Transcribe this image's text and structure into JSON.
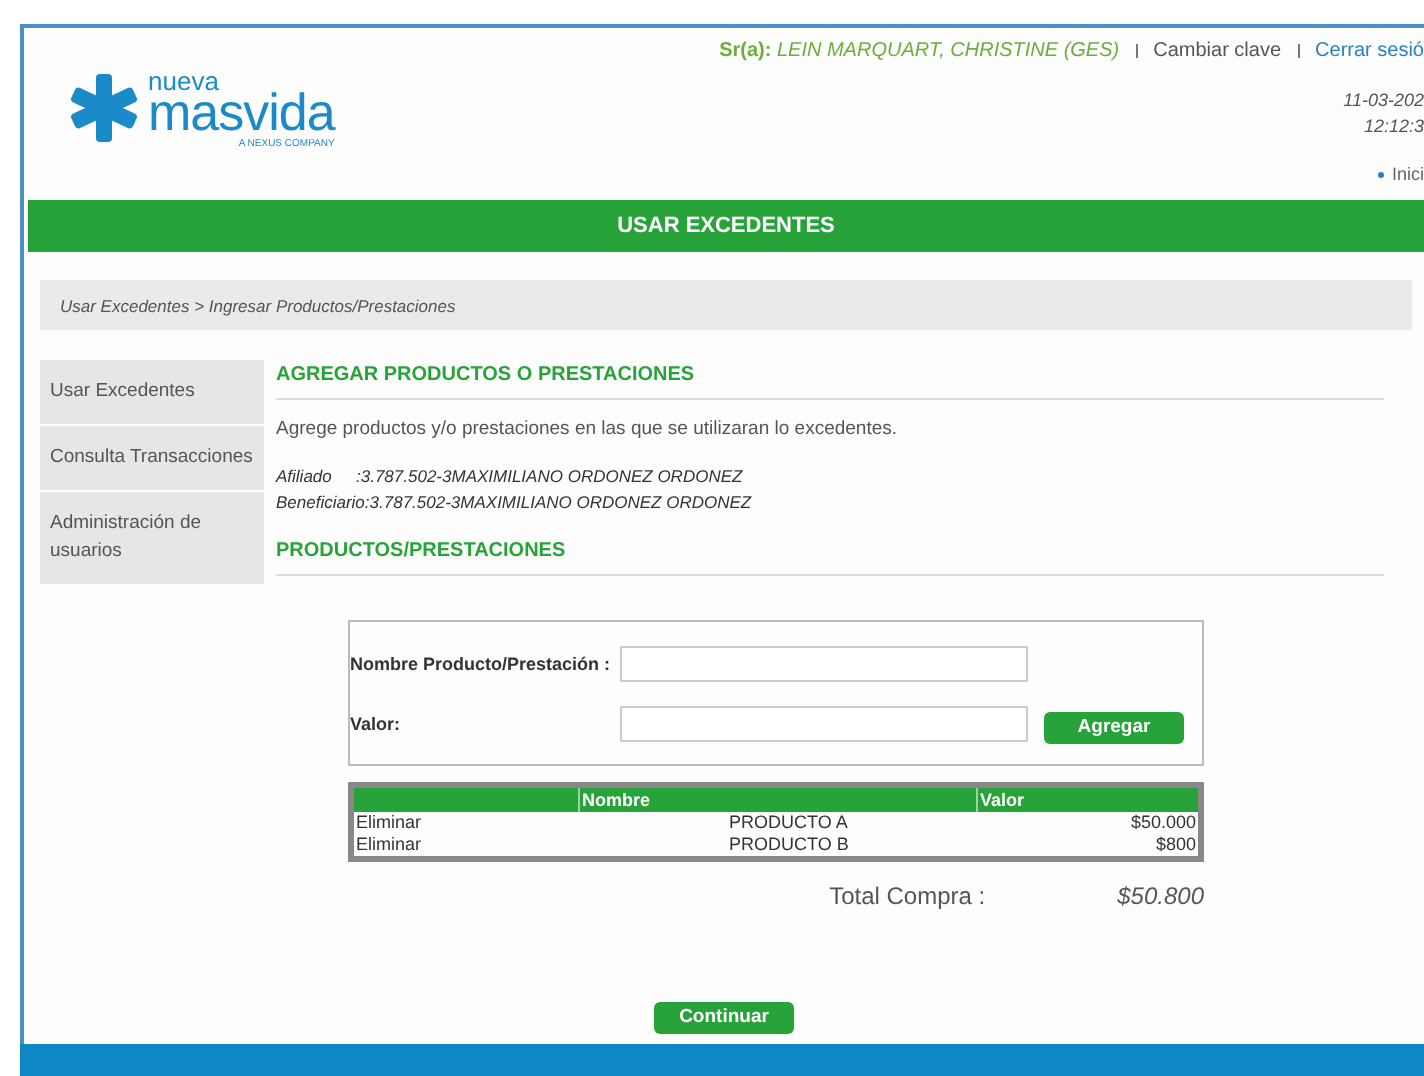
{
  "header": {
    "logo": {
      "small": "nueva",
      "big": "masvida",
      "tagline": "A NEXUS COMPANY"
    },
    "user_label": "Sr(a):",
    "user_name": "LEIN MARQUART, CHRISTINE (GES)",
    "links": [
      {
        "label": "Cambiar clave",
        "kind": "plain"
      },
      {
        "label": "Cerrar sesió",
        "kind": "link"
      }
    ],
    "date": "11-03-202",
    "time": "12:12:3",
    "home_link": "Inici"
  },
  "banner": {
    "title": "USAR EXCEDENTES"
  },
  "breadcrumb": "Usar Excedentes > Ingresar Productos/Prestaciones",
  "sidebar": {
    "items": [
      {
        "label": "Usar Excedentes"
      },
      {
        "label": "Consulta Transacciones"
      },
      {
        "label": "Administración de usuarios"
      }
    ]
  },
  "main": {
    "title": "AGREGAR PRODUCTOS O PRESTACIONES",
    "description": "Agrege productos y/o prestaciones en las que se utilizaran lo excedentes.",
    "info": [
      {
        "label": "Afiliado",
        "value": ":3.787.502-3MAXIMILIANO ORDONEZ ORDONEZ"
      },
      {
        "label": "Beneficiario",
        "value": ":3.787.502-3MAXIMILIANO ORDONEZ ORDONEZ"
      }
    ],
    "section_title": "PRODUCTOS/PRESTACIONES",
    "form": {
      "fields": [
        {
          "label": "Nombre Producto/Prestación :"
        },
        {
          "label": "Valor:"
        }
      ],
      "button": "Agregar"
    },
    "table": {
      "columns": [
        "",
        "Nombre",
        "Valor"
      ],
      "rows": [
        {
          "action": "Eliminar",
          "name": "PRODUCTO A",
          "value": "$50.000"
        },
        {
          "action": "Eliminar",
          "name": "PRODUCTO B",
          "value": "$800"
        }
      ]
    },
    "total_label": "Total Compra :",
    "total_value": "$50.800",
    "continue_button": "Continuar"
  }
}
